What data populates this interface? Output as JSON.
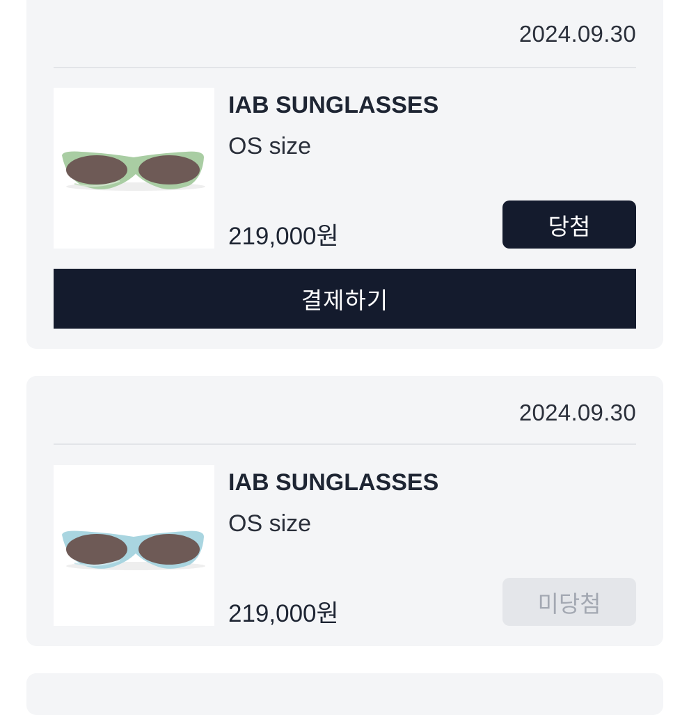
{
  "orders": [
    {
      "date": "2024.09.30",
      "product_name": "IAB SUNGLASSES",
      "size": "OS size",
      "price": "219,000원",
      "status": "당첨",
      "action_label": "결제하기",
      "frame_color": "#a9cda3",
      "lens_color": "#6e5a56"
    },
    {
      "date": "2024.09.30",
      "product_name": "IAB SUNGLASSES",
      "size": "OS size",
      "price": "219,000원",
      "status": "미당첨",
      "frame_color": "#a9d5e0",
      "lens_color": "#6e5a56"
    }
  ],
  "colors": {
    "card_bg": "#f4f5f7",
    "primary_dark": "#141b2d",
    "inactive_bg": "#e4e6ea",
    "inactive_text": "#a3a8b2"
  }
}
